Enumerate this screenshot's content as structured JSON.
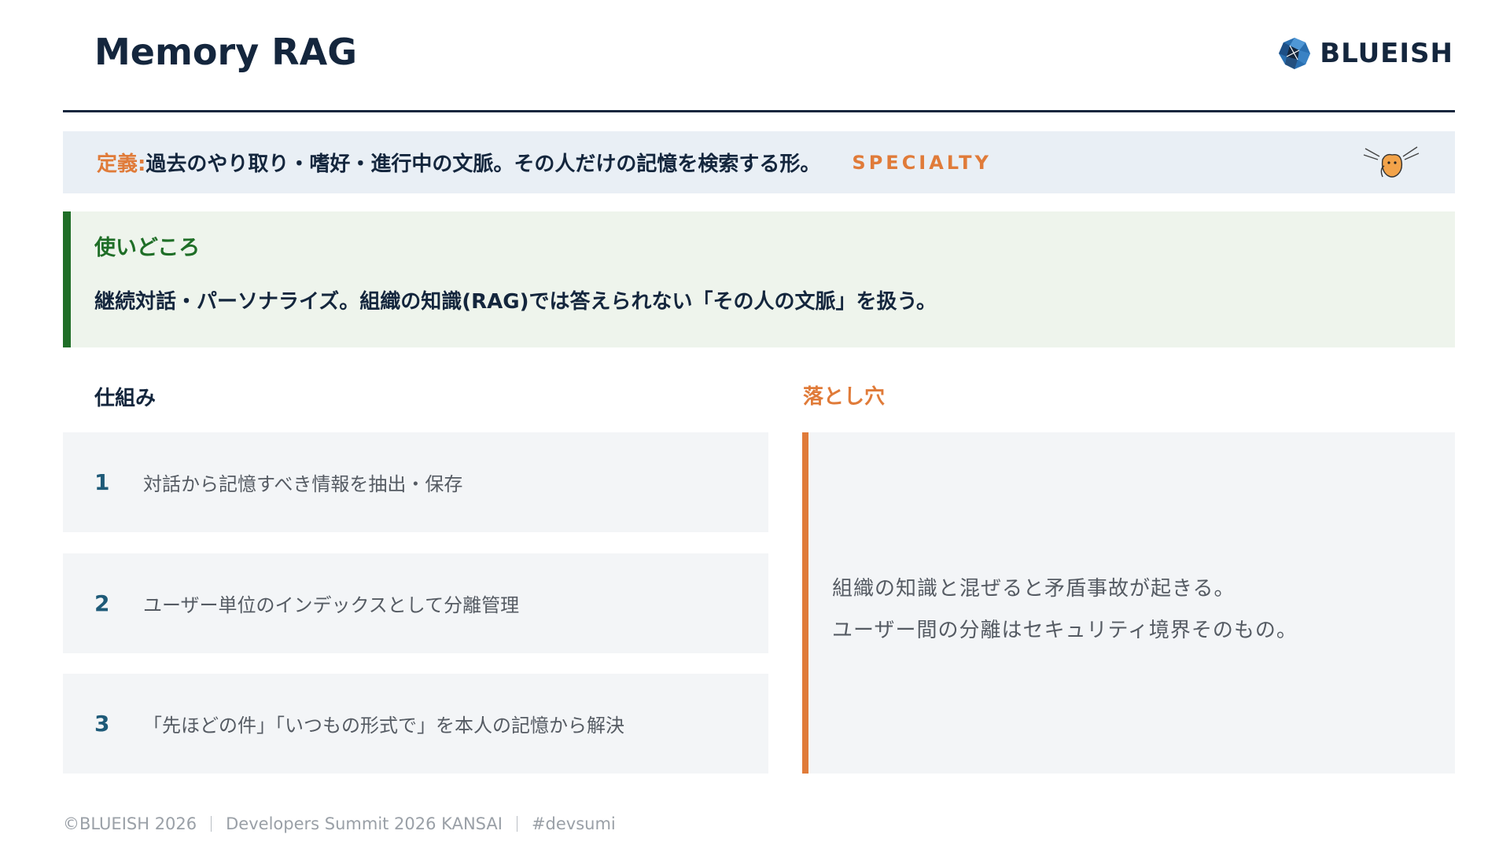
{
  "header": {
    "title": "Memory RAG",
    "logo_text": "BLUEISH"
  },
  "definition": {
    "label": "定義:",
    "text": "過去のやり取り・嗜好・進行中の文脈。その人だけの記憶を検索する形。",
    "tag": "SPECIALTY"
  },
  "usage": {
    "heading": "使いどころ",
    "text": "継続対話・パーソナライズ。組織の知識(RAG)では答えられない「その人の文脈」を扱う。"
  },
  "mechanism": {
    "heading": "仕組み",
    "steps": [
      {
        "num": "1",
        "text": "対話から記憶すべき情報を抽出・保存"
      },
      {
        "num": "2",
        "text": "ユーザー単位のインデックスとして分離管理"
      },
      {
        "num": "3",
        "text": "「先ほどの件」「いつもの形式で」を本人の記憶から解決"
      }
    ]
  },
  "pitfall": {
    "heading": "落とし穴",
    "lines": [
      "組織の知識と混ぜると矛盾事故が起きる。",
      "ユーザー間の分離はセキュリティ境界そのもの。"
    ]
  },
  "footer": {
    "copyright": "©BLUEISH 2026",
    "event": "Developers Summit 2026 KANSAI",
    "hashtag": "#devsumi"
  },
  "colors": {
    "navy": "#14263d",
    "orange": "#e07b39",
    "green": "#1f6e27",
    "step_number": "#1e5a78"
  }
}
